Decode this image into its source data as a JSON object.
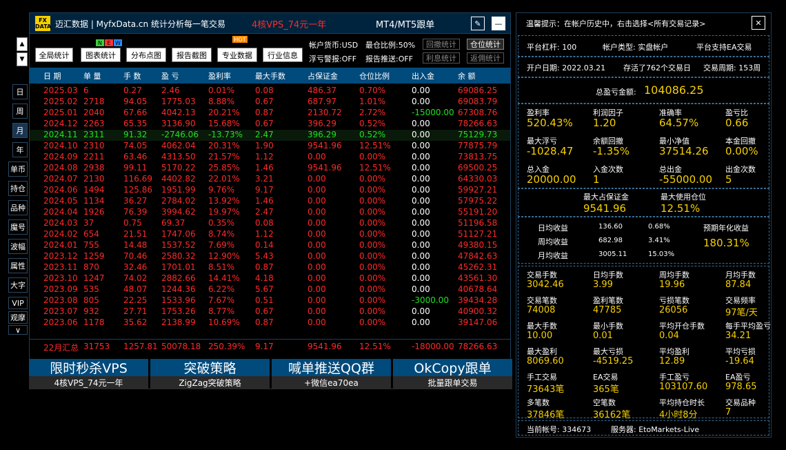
{
  "nav": {
    "up": "▲",
    "down": "▼"
  },
  "sidetabs": [
    "日",
    "周",
    "月",
    "年",
    "单币",
    "持仓",
    "品种",
    "魔号",
    "波幅",
    "属性",
    "大字",
    "VIP",
    "观摩",
    "∨"
  ],
  "header": {
    "logo_top": "FX",
    "logo_bottom": "DATA",
    "brand": "迈汇数据 | MyfxData.cn",
    "slogan": "统计分析每一笔交易",
    "promo": "4核VPS_74元一年",
    "follow": "MT4/MT5跟单",
    "edit_icon": "✎",
    "min_icon": "—"
  },
  "toolbar": {
    "buttons": [
      "全局统计",
      "图表统计",
      "分布点图",
      "报告截图",
      "专业数据",
      "行业信息"
    ],
    "badges": [
      "N",
      "E",
      "W"
    ],
    "hot": "HOT",
    "currency": "帐户货币:USD",
    "margin_ratio": "最仓比例:50%",
    "float_alert": "浮亏警报:OFF",
    "report_push": "报告推送:OFF",
    "grey_btns": [
      "回撤统计",
      "利息统计",
      "返佣统计"
    ],
    "pos_btn": "仓位统计"
  },
  "table": {
    "headers": [
      "日 期",
      "单 量",
      "手 数",
      "盈 亏",
      "盈利率",
      "最大手数",
      "占保证金",
      "仓位比例",
      "出入金",
      "余 额"
    ],
    "rows": [
      {
        "c": [
          "2025.03",
          "6",
          "0.27",
          "2.46",
          "0.01%",
          "0.08",
          "486.37",
          "0.70%",
          "0.00",
          "69086.25"
        ],
        "color": "red"
      },
      {
        "c": [
          "2025.02",
          "2718",
          "94.05",
          "1775.03",
          "8.88%",
          "0.67",
          "687.97",
          "1.01%",
          "0.00",
          "69083.79"
        ],
        "color": "red"
      },
      {
        "c": [
          "2025.01",
          "2040",
          "67.66",
          "4042.13",
          "20.21%",
          "0.87",
          "2130.72",
          "2.72%",
          "-15000.00",
          "67308.76"
        ],
        "color": "red"
      },
      {
        "c": [
          "2024.12",
          "2263",
          "65.35",
          "3136.90",
          "15.68%",
          "0.67",
          "396.29",
          "0.52%",
          "0.00",
          "78266.63"
        ],
        "color": "red"
      },
      {
        "c": [
          "2024.11",
          "2311",
          "91.32",
          "-2746.06",
          "-13.73%",
          "2.47",
          "396.29",
          "0.52%",
          "0.00",
          "75129.73"
        ],
        "color": "green"
      },
      {
        "c": [
          "2024.10",
          "2310",
          "74.05",
          "4062.04",
          "20.31%",
          "1.90",
          "9541.96",
          "12.51%",
          "0.00",
          "77875.79"
        ],
        "color": "red"
      },
      {
        "c": [
          "2024.09",
          "2211",
          "63.46",
          "4313.50",
          "21.57%",
          "1.12",
          "0.00",
          "0.00%",
          "0.00",
          "73813.75"
        ],
        "color": "red"
      },
      {
        "c": [
          "2024.08",
          "2938",
          "99.11",
          "5170.22",
          "25.85%",
          "1.46",
          "9541.96",
          "12.51%",
          "0.00",
          "69500.25"
        ],
        "color": "red"
      },
      {
        "c": [
          "2024.07",
          "2130",
          "116.69",
          "4402.82",
          "22.01%",
          "3.21",
          "0.00",
          "0.00%",
          "0.00",
          "64330.03"
        ],
        "color": "red"
      },
      {
        "c": [
          "2024.06",
          "1494",
          "125.86",
          "1951.99",
          "9.76%",
          "9.17",
          "0.00",
          "0.00%",
          "0.00",
          "59927.21"
        ],
        "color": "red"
      },
      {
        "c": [
          "2024.05",
          "1134",
          "36.27",
          "2784.02",
          "13.92%",
          "1.46",
          "0.00",
          "0.00%",
          "0.00",
          "57975.22"
        ],
        "color": "red"
      },
      {
        "c": [
          "2024.04",
          "1926",
          "76.39",
          "3994.62",
          "19.97%",
          "2.47",
          "0.00",
          "0.00%",
          "0.00",
          "55191.20"
        ],
        "color": "red"
      },
      {
        "c": [
          "2024.03",
          "37",
          "0.75",
          "69.37",
          "0.35%",
          "0.08",
          "0.00",
          "0.00%",
          "0.00",
          "51196.58"
        ],
        "color": "red"
      },
      {
        "c": [
          "2024.02",
          "654",
          "21.51",
          "1747.06",
          "8.74%",
          "1.12",
          "0.00",
          "0.00%",
          "0.00",
          "51127.21"
        ],
        "color": "red"
      },
      {
        "c": [
          "2024.01",
          "755",
          "14.48",
          "1537.52",
          "7.69%",
          "0.14",
          "0.00",
          "0.00%",
          "0.00",
          "49380.15"
        ],
        "color": "red"
      },
      {
        "c": [
          "2023.12",
          "1259",
          "70.46",
          "2580.32",
          "12.90%",
          "5.43",
          "0.00",
          "0.00%",
          "0.00",
          "47842.63"
        ],
        "color": "red"
      },
      {
        "c": [
          "2023.11",
          "870",
          "32.46",
          "1701.01",
          "8.51%",
          "0.87",
          "0.00",
          "0.00%",
          "0.00",
          "45262.31"
        ],
        "color": "red"
      },
      {
        "c": [
          "2023.10",
          "1247",
          "74.02",
          "2882.66",
          "14.41%",
          "4.18",
          "0.00",
          "0.00%",
          "0.00",
          "43561.30"
        ],
        "color": "red"
      },
      {
        "c": [
          "2023.09",
          "535",
          "48.07",
          "1244.36",
          "6.22%",
          "5.67",
          "0.00",
          "0.00%",
          "0.00",
          "40678.64"
        ],
        "color": "red"
      },
      {
        "c": [
          "2023.08",
          "805",
          "22.25",
          "1533.96",
          "7.67%",
          "0.51",
          "0.00",
          "0.00%",
          "-3000.00",
          "39434.28"
        ],
        "color": "red"
      },
      {
        "c": [
          "2023.07",
          "932",
          "27.71",
          "1753.26",
          "8.77%",
          "0.67",
          "0.00",
          "0.00%",
          "0.00",
          "40900.32"
        ],
        "color": "red"
      },
      {
        "c": [
          "2023.06",
          "1178",
          "35.62",
          "2138.99",
          "10.69%",
          "0.87",
          "0.00",
          "0.00%",
          "0.00",
          "39147.06"
        ],
        "color": "red"
      }
    ],
    "summary": [
      "22月汇总",
      "31753",
      "1257.81",
      "50078.18",
      "250.39%",
      "9.17",
      "9541.96",
      "12.51%",
      "-18000.00",
      "78266.63"
    ]
  },
  "banners": [
    {
      "top": "限时秒杀VPS",
      "bottom": "4核VPS_74元一年"
    },
    {
      "top": "突破策略",
      "bottom": "ZigZag突破策略"
    },
    {
      "top": "喊单推送QQ群",
      "bottom": "+微信ea70ea"
    },
    {
      "top": "OkCopy跟单",
      "bottom": "批量跟单交易"
    }
  ],
  "right": {
    "tip": "温馨提示：在帐户历史中，右击选择<所有交易记录>",
    "close": "✕",
    "leverage": "平台杠杆:   100",
    "acct_type": "帐户类型:  实盘帐户",
    "ea": "平台支持EA交易",
    "open_date": "开户日期:   2022.03.21",
    "days": "存活了762个交易日",
    "cycle": "交易周期:   153周",
    "total_label": "总盈亏金额:",
    "total_value": "104086.25",
    "stats1": [
      {
        "l": "盈利率",
        "v": "520.43%"
      },
      {
        "l": "利润因子",
        "v": "1.20"
      },
      {
        "l": "准确率",
        "v": "64.57%"
      },
      {
        "l": "盈亏比",
        "v": "0.66"
      },
      {
        "l": "最大浮亏",
        "v": "-1028.47"
      },
      {
        "l": "余额回撤",
        "v": "-1.35%"
      },
      {
        "l": "最小净值",
        "v": "37514.26"
      },
      {
        "l": "本金回撤",
        "v": "0.00%"
      },
      {
        "l": "总入金",
        "v": "20000.00"
      },
      {
        "l": "入金次数",
        "v": "1"
      },
      {
        "l": "总出金",
        "v": "-55000.00"
      },
      {
        "l": "出金次数",
        "v": "5"
      }
    ],
    "margin_label": "最大占保证金",
    "margin_value": "9541.96",
    "usage_label": "最大使用仓位",
    "usage_value": "12.51%",
    "avg": [
      {
        "l": "日均收益",
        "a": "136.60",
        "b": "0.68%"
      },
      {
        "l": "周均收益",
        "a": "682.98",
        "b": "3.41%"
      },
      {
        "l": "月均收益",
        "a": "3005.11",
        "b": "15.03%"
      }
    ],
    "annual_label": "预期年化收益",
    "annual_value": "180.31%",
    "stats2": [
      {
        "l": "交易手数",
        "v": "3042.46"
      },
      {
        "l": "日均手数",
        "v": "3.99"
      },
      {
        "l": "周均手数",
        "v": "19.96"
      },
      {
        "l": "月均手数",
        "v": "87.84"
      },
      {
        "l": "交易笔数",
        "v": "74008"
      },
      {
        "l": "盈利笔数",
        "v": "47785"
      },
      {
        "l": "亏损笔数",
        "v": "26056"
      },
      {
        "l": "交易频率",
        "v": "97笔/天"
      },
      {
        "l": "最大手数",
        "v": "10.00"
      },
      {
        "l": "最小手数",
        "v": "0.01"
      },
      {
        "l": "平均开仓手数",
        "v": "0.04"
      },
      {
        "l": "每手平均盈亏",
        "v": "34.21"
      },
      {
        "l": "最大盈利",
        "v": "8069.60"
      },
      {
        "l": "最大亏损",
        "v": "-4519.25"
      },
      {
        "l": "平均盈利",
        "v": "12.89"
      },
      {
        "l": "平均亏损",
        "v": "-19.64"
      },
      {
        "l": "手工交易",
        "v": "73643笔"
      },
      {
        "l": "EA交易",
        "v": "365笔"
      },
      {
        "l": "手工盈亏",
        "v": "103107.60"
      },
      {
        "l": "EA盈亏",
        "v": "978.65"
      },
      {
        "l": "多笔数",
        "v": "37846笔"
      },
      {
        "l": "空笔数",
        "v": "36162笔"
      },
      {
        "l": "平均持仓时长",
        "v": "4小时8分"
      },
      {
        "l": "交易品种",
        "v": "7"
      }
    ],
    "account": "当前帐号:   334673",
    "server": "服务器:   EtoMarkets-Live"
  },
  "colors": {
    "accent": "#f5d000",
    "header": "#004a7c",
    "titlebar": "#00243e",
    "profit": "#ff2a2a",
    "loss": "#21e021"
  }
}
